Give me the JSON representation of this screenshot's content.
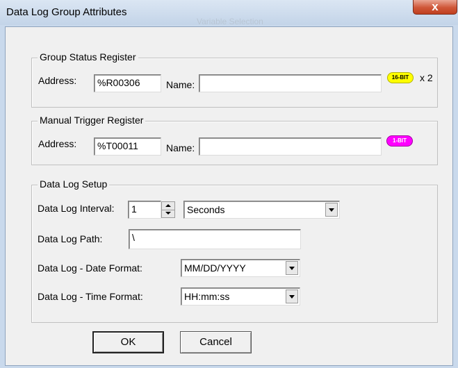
{
  "window": {
    "title": "Data Log Group Attributes",
    "background_title": "Variable Selection",
    "close_glyph": "x"
  },
  "group_status": {
    "legend": "Group Status Register",
    "address_label": "Address:",
    "address_value": "%R00306",
    "name_label": "Name:",
    "name_value": "",
    "badge": "16-BIT",
    "multiplier": "x 2"
  },
  "manual_trigger": {
    "legend": "Manual Trigger Register",
    "address_label": "Address:",
    "address_value": "%T00011",
    "name_label": "Name:",
    "name_value": "",
    "badge": "1-BIT"
  },
  "setup": {
    "legend": "Data Log Setup",
    "interval_label": "Data Log Interval:",
    "interval_value": "1",
    "interval_unit": "Seconds",
    "path_label": "Data Log Path:",
    "path_value": "\\",
    "date_format_label": "Data Log  -  Date Format:",
    "date_format_value": "MM/DD/YYYY",
    "time_format_label": "Data Log  -  Time Format:",
    "time_format_value": "HH:mm:ss"
  },
  "buttons": {
    "ok": "OK",
    "cancel": "Cancel"
  },
  "colors": {
    "badge_16bit": "#ffff00",
    "badge_1bit": "#ff00ff",
    "close_button": "#cf5638"
  }
}
